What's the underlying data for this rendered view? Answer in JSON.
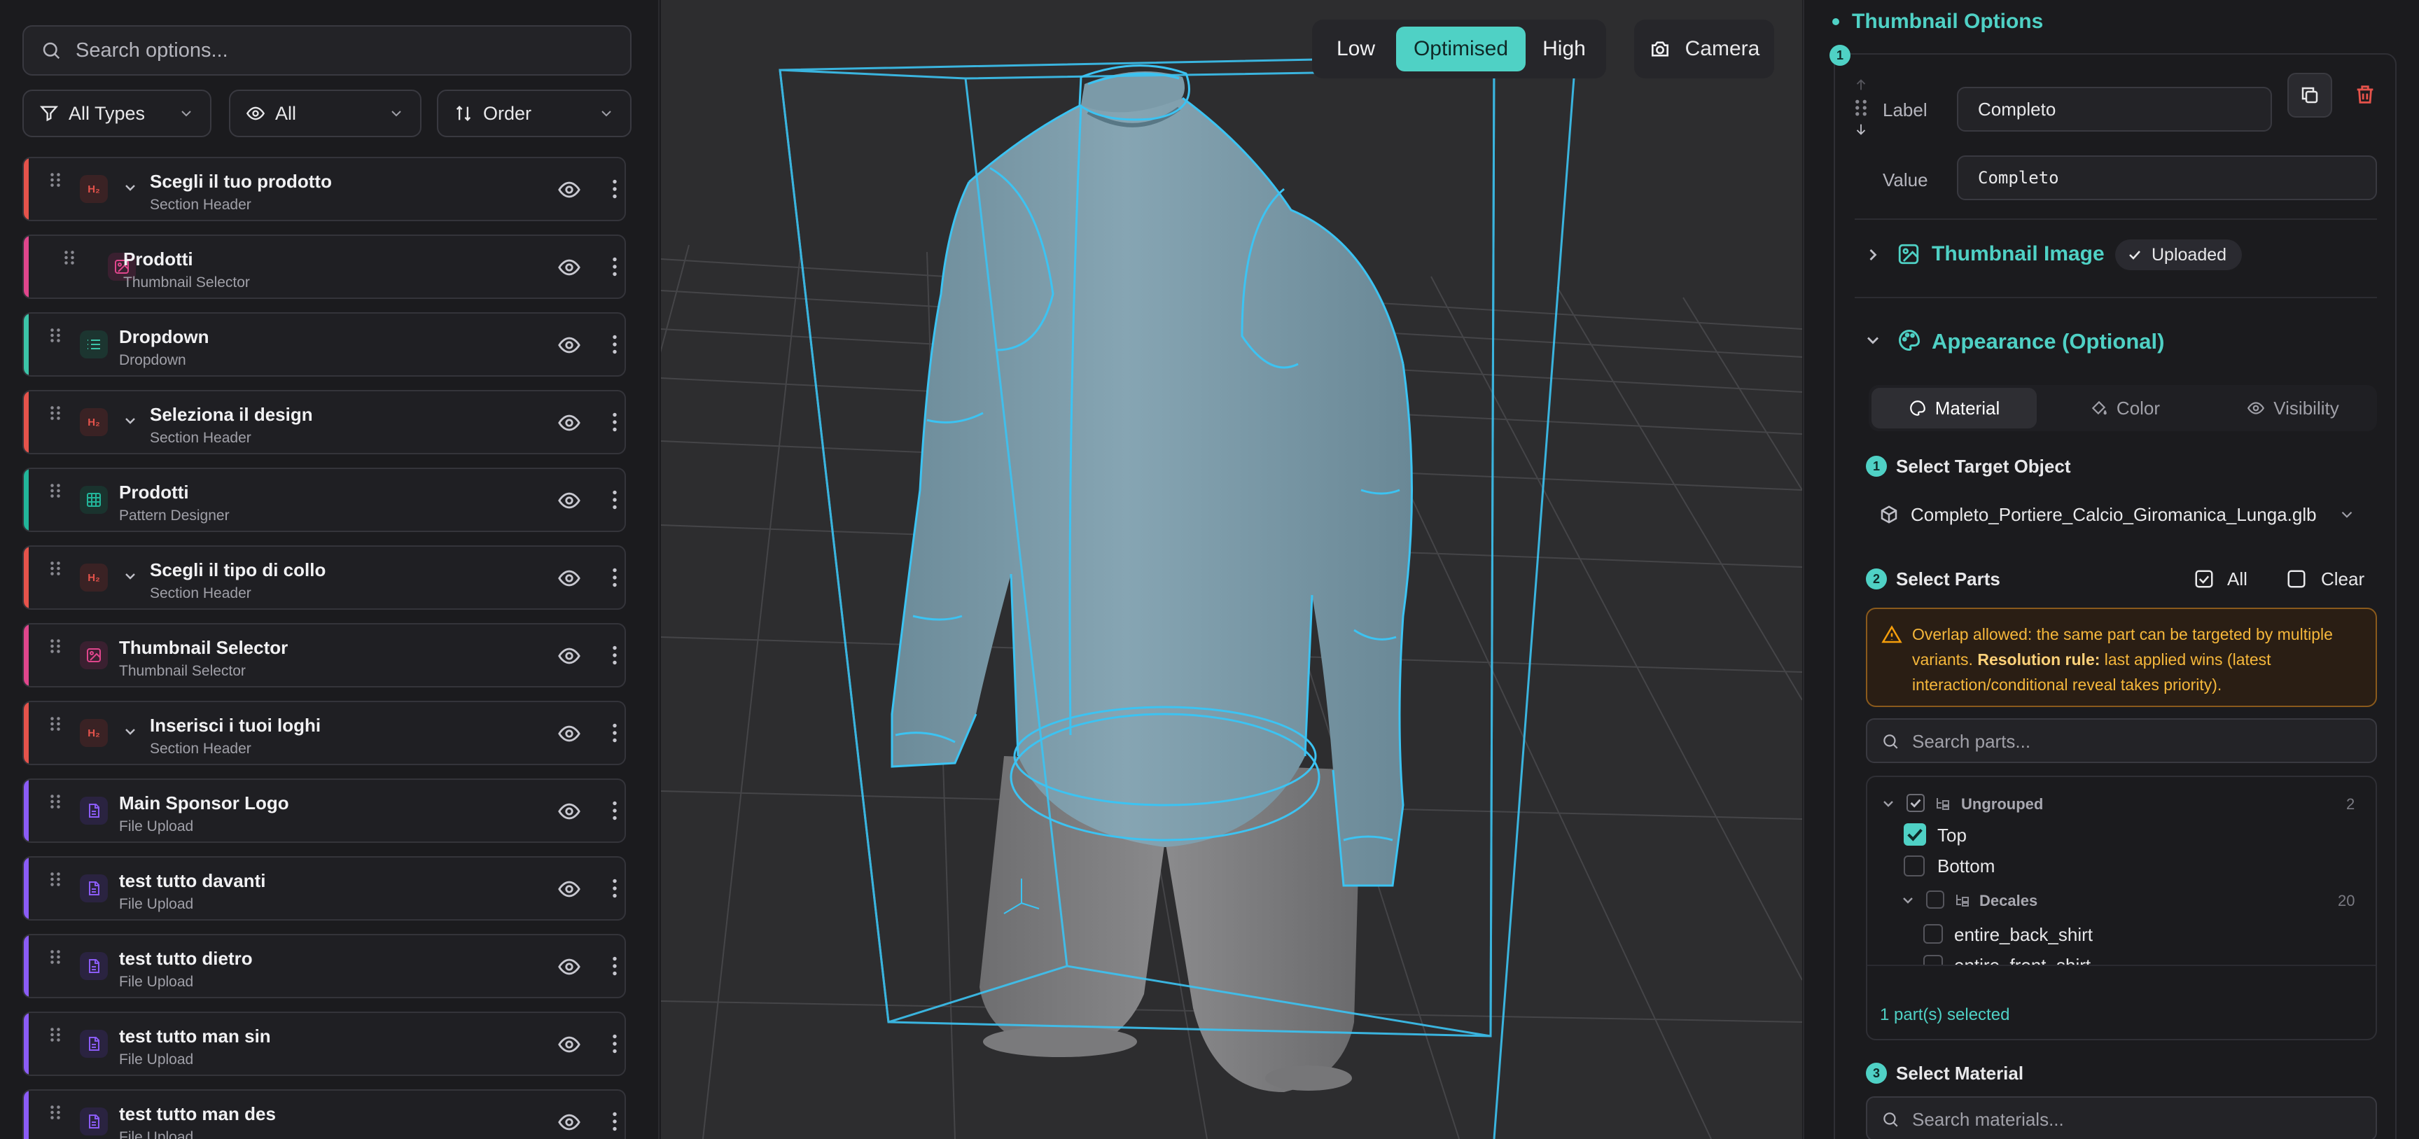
{
  "left_panel": {
    "search_placeholder": "Search options...",
    "filters": [
      {
        "label": "All Types",
        "icon": "funnel-icon"
      },
      {
        "label": "All",
        "icon": "eye-icon"
      },
      {
        "label": "Order",
        "icon": "sort-arrows-icon"
      }
    ],
    "items": [
      {
        "title": "Scegli il tuo prodotto",
        "subtitle": "Section Header",
        "icon": "h2",
        "bar_color": "#e5534b",
        "collapsible": true
      },
      {
        "title": "Prodotti",
        "subtitle": "Thumbnail Selector",
        "icon": "image",
        "bar_color": "#e0468c",
        "collapsible": false
      },
      {
        "title": "Dropdown",
        "subtitle": "Dropdown",
        "icon": "list",
        "bar_color": "#3cc4a8",
        "collapsible": false
      },
      {
        "title": "Seleziona il design",
        "subtitle": "Section Header",
        "icon": "h2",
        "bar_color": "#e5534b",
        "collapsible": true
      },
      {
        "title": "Prodotti",
        "subtitle": "Pattern Designer",
        "icon": "grid",
        "bar_color": "#22b59a",
        "collapsible": false
      },
      {
        "title": "Scegli il tipo di collo",
        "subtitle": "Section Header",
        "icon": "h2",
        "bar_color": "#e5534b",
        "collapsible": true
      },
      {
        "title": "Thumbnail Selector",
        "subtitle": "Thumbnail Selector",
        "icon": "image",
        "bar_color": "#e0468c",
        "collapsible": false
      },
      {
        "title": "Inserisci i tuoi loghi",
        "subtitle": "Section Header",
        "icon": "h2",
        "bar_color": "#e5534b",
        "collapsible": true
      },
      {
        "title": "Main Sponsor Logo",
        "subtitle": "File Upload",
        "icon": "file",
        "bar_color": "#8b5cf6",
        "collapsible": false
      },
      {
        "title": "test tutto davanti",
        "subtitle": "File Upload",
        "icon": "file",
        "bar_color": "#8b5cf6",
        "collapsible": false
      },
      {
        "title": "test tutto dietro",
        "subtitle": "File Upload",
        "icon": "file",
        "bar_color": "#8b5cf6",
        "collapsible": false
      },
      {
        "title": "test tutto man sin",
        "subtitle": "File Upload",
        "icon": "file",
        "bar_color": "#8b5cf6",
        "collapsible": false
      },
      {
        "title": "test tutto man des",
        "subtitle": "File Upload",
        "icon": "file",
        "bar_color": "#8b5cf6",
        "collapsible": false
      }
    ]
  },
  "viewport": {
    "quality": {
      "low": "Low",
      "optimised": "Optimised",
      "high": "High",
      "active": "Optimised"
    },
    "camera_label": "Camera"
  },
  "right_panel": {
    "section_title": "Thumbnail Options",
    "variant_index": "1",
    "label_caption": "Label",
    "label_value": "Completo",
    "value_caption": "Value",
    "value_value": "Completo",
    "thumbnail_image": {
      "title": "Thumbnail Image",
      "status": "Uploaded"
    },
    "appearance": {
      "title": "Appearance (Optional)",
      "tabs": [
        "Material",
        "Color",
        "Visibility"
      ],
      "active_tab": "Material",
      "step1": {
        "num": "1",
        "title": "Select Target Object",
        "object": "Completo_Portiere_Calcio_Giromanica_Lunga.glb"
      },
      "step2": {
        "num": "2",
        "title": "Select Parts",
        "all_label": "All",
        "clear_label": "Clear",
        "warning_prefix": "Overlap allowed: the same part can be targeted by multiple variants. ",
        "warning_rule": "Resolution rule:",
        "warning_suffix": " last applied wins (latest interaction/conditional reveal takes priority).",
        "search_placeholder": "Search parts...",
        "group_ungrouped": "Ungrouped",
        "group_ungrouped_count": "2",
        "part_top": "Top",
        "part_bottom": "Bottom",
        "group_decales": "Decales",
        "group_decales_count": "20",
        "part_back": "entire_back_shirt",
        "part_front": "entire_front_shirt",
        "selected_count": "1 part(s) selected"
      },
      "step3": {
        "num": "3",
        "title": "Select Material",
        "search_placeholder": "Search materials..."
      }
    }
  },
  "colors": {
    "accent": "#4fd1c5",
    "wire": "#3cc3f2",
    "warning": "#f59e0b",
    "danger": "#e5534b"
  }
}
